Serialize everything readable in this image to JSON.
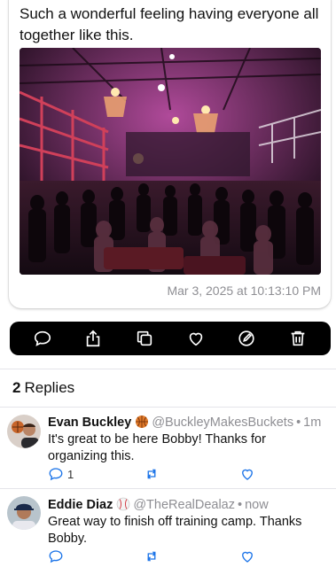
{
  "post": {
    "text": "Such a wonderful feeling having everyone all together like this.",
    "timestamp": "Mar 3, 2025 at 10:13:10 PM"
  },
  "actions": [
    {
      "name": "reply-button",
      "icon": "speech-bubble-icon"
    },
    {
      "name": "share-button",
      "icon": "share-icon"
    },
    {
      "name": "copy-button",
      "icon": "copy-icon"
    },
    {
      "name": "like-button",
      "icon": "heart-icon"
    },
    {
      "name": "edit-button",
      "icon": "pencil-circle-icon"
    },
    {
      "name": "delete-button",
      "icon": "trash-icon"
    }
  ],
  "replies_header": {
    "count": "2",
    "label": "Replies"
  },
  "replies": [
    {
      "name": "Evan Buckley",
      "emoji": "basketball-emoji",
      "handle": "@BuckleyMakesBuckets",
      "time": "1m",
      "text": "It's great to be here Bobby! Thanks for organizing this.",
      "reply_count": "1"
    },
    {
      "name": "Eddie Diaz",
      "emoji": "baseball-emoji",
      "handle": "@TheRealDealaz",
      "time": "now",
      "text": "Great way to finish off training camp. Thanks Bobby.",
      "reply_count": ""
    }
  ],
  "colors": {
    "action_bar_bg": "#000000",
    "secondary_text": "#8e8e93",
    "divider": "#e5e5ea"
  }
}
